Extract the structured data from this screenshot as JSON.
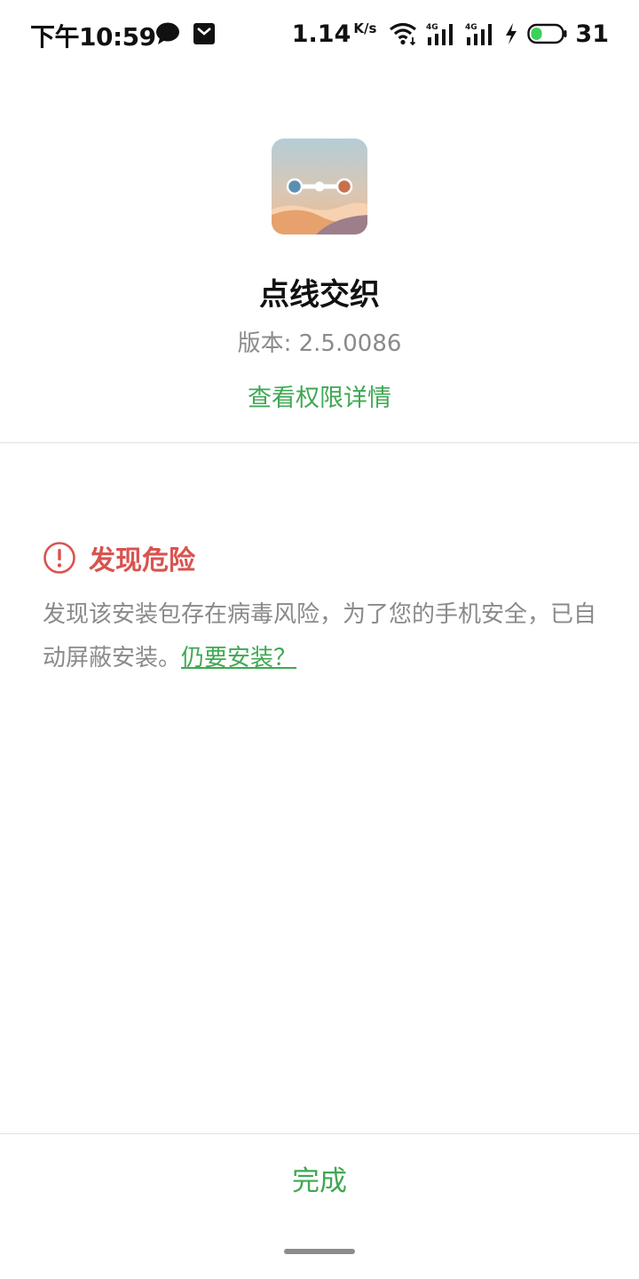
{
  "status_bar": {
    "time": "下午10:59",
    "net_speed": "1.14",
    "net_speed_unit": "K/s",
    "battery_level": "31",
    "icons": [
      "chat-icon",
      "mail-icon",
      "wifi-icon",
      "signal-4g-icon",
      "signal-4g-icon",
      "charging-icon",
      "battery-icon"
    ]
  },
  "app": {
    "name": "点线交织",
    "version": "版本: 2.5.0086",
    "permission_link": "查看权限详情",
    "icon": "app-icon"
  },
  "warning": {
    "title": "发现危险",
    "message": "发现该安装包存在病毒风险，为了您的手机安全，已自动屏蔽安装。",
    "install_anyway": "仍要安装？"
  },
  "footer": {
    "done_label": "完成"
  },
  "colors": {
    "accent_green": "#3fa853",
    "danger_red": "#d9534f",
    "secondary_text": "#8a8a8a"
  }
}
